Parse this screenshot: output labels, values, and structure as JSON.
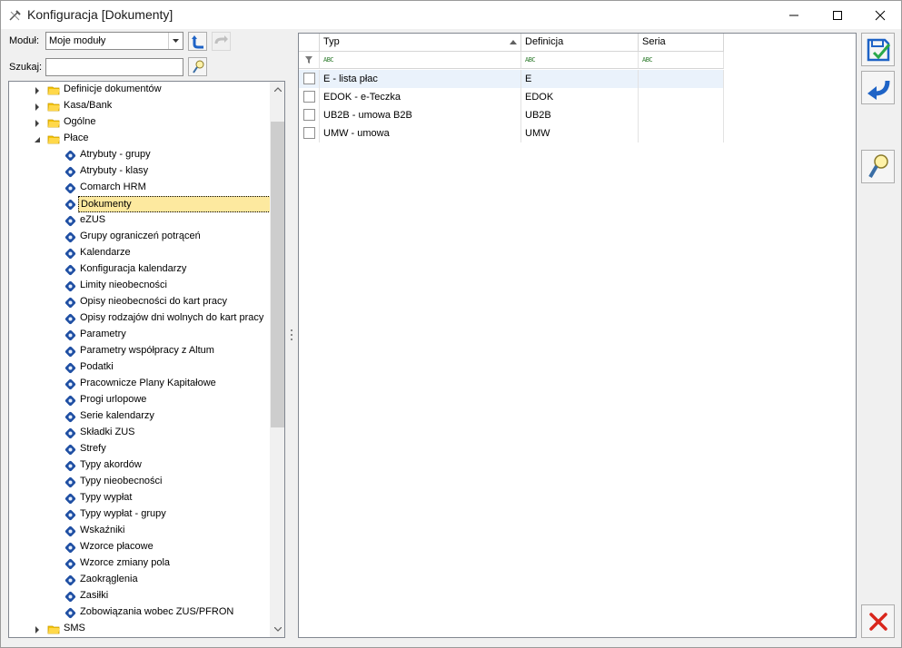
{
  "window": {
    "title": "Konfiguracja [Dokumenty]"
  },
  "toolbar": {
    "module_label": "Moduł:",
    "module_value": "Moje moduły",
    "search_label": "Szukaj:",
    "search_value": ""
  },
  "tree": {
    "items": [
      {
        "label": "Definicje dokumentów",
        "level": 0,
        "expander": "collapsed",
        "icon": "folder-icon"
      },
      {
        "label": "Kasa/Bank",
        "level": 0,
        "expander": "collapsed",
        "icon": "folder-icon"
      },
      {
        "label": "Ogólne",
        "level": 0,
        "expander": "collapsed",
        "icon": "folder-icon"
      },
      {
        "label": "Płace",
        "level": 0,
        "expander": "expanded",
        "icon": "folder-open-icon"
      },
      {
        "label": "Atrybuty - grupy",
        "level": 1,
        "icon": "config-item-icon"
      },
      {
        "label": "Atrybuty - klasy",
        "level": 1,
        "icon": "config-item-icon"
      },
      {
        "label": "Comarch HRM",
        "level": 1,
        "icon": "config-item-icon"
      },
      {
        "label": "Dokumenty",
        "level": 1,
        "icon": "config-item-icon",
        "selected": true
      },
      {
        "label": "eZUS",
        "level": 1,
        "icon": "config-item-icon"
      },
      {
        "label": "Grupy ograniczeń potrąceń",
        "level": 1,
        "icon": "config-item-icon"
      },
      {
        "label": "Kalendarze",
        "level": 1,
        "icon": "config-item-icon"
      },
      {
        "label": "Konfiguracja kalendarzy",
        "level": 1,
        "icon": "config-item-icon"
      },
      {
        "label": "Limity nieobecności",
        "level": 1,
        "icon": "config-item-icon"
      },
      {
        "label": "Opisy nieobecności do kart pracy",
        "level": 1,
        "icon": "config-item-icon"
      },
      {
        "label": "Opisy rodzajów dni wolnych do kart pracy",
        "level": 1,
        "icon": "config-item-icon"
      },
      {
        "label": "Parametry",
        "level": 1,
        "icon": "config-item-icon"
      },
      {
        "label": "Parametry współpracy z Altum",
        "level": 1,
        "icon": "config-item-icon"
      },
      {
        "label": "Podatki",
        "level": 1,
        "icon": "config-item-icon"
      },
      {
        "label": "Pracownicze Plany Kapitałowe",
        "level": 1,
        "icon": "config-item-icon"
      },
      {
        "label": "Progi urlopowe",
        "level": 1,
        "icon": "config-item-icon"
      },
      {
        "label": "Serie kalendarzy",
        "level": 1,
        "icon": "config-item-icon"
      },
      {
        "label": "Składki ZUS",
        "level": 1,
        "icon": "config-item-icon"
      },
      {
        "label": "Strefy",
        "level": 1,
        "icon": "config-item-icon"
      },
      {
        "label": "Typy akordów",
        "level": 1,
        "icon": "config-item-icon"
      },
      {
        "label": "Typy nieobecności",
        "level": 1,
        "icon": "config-item-icon"
      },
      {
        "label": "Typy wypłat",
        "level": 1,
        "icon": "config-item-icon"
      },
      {
        "label": "Typy wypłat - grupy",
        "level": 1,
        "icon": "config-item-icon"
      },
      {
        "label": "Wskaźniki",
        "level": 1,
        "icon": "config-item-icon"
      },
      {
        "label": "Wzorce płacowe",
        "level": 1,
        "icon": "config-item-icon"
      },
      {
        "label": "Wzorce zmiany pola",
        "level": 1,
        "icon": "config-item-icon"
      },
      {
        "label": "Zaokrąglenia",
        "level": 1,
        "icon": "config-item-icon"
      },
      {
        "label": "Zasiłki",
        "level": 1,
        "icon": "config-item-icon"
      },
      {
        "label": "Zobowiązania wobec ZUS/PFRON",
        "level": 1,
        "icon": "config-item-icon"
      },
      {
        "label": "SMS",
        "level": 0,
        "expander": "collapsed",
        "icon": "folder-icon"
      }
    ]
  },
  "grid": {
    "columns": [
      "Typ",
      "Definicja",
      "Seria"
    ],
    "filter_glyph": "ABC",
    "rows": [
      {
        "typ": "E - lista płac",
        "definicja": "E",
        "seria": ""
      },
      {
        "typ": "EDOK - e-Teczka",
        "definicja": "EDOK",
        "seria": ""
      },
      {
        "typ": "UB2B - umowa B2B",
        "definicja": "UB2B",
        "seria": ""
      },
      {
        "typ": "UMW - umowa",
        "definicja": "UMW",
        "seria": ""
      }
    ]
  },
  "colors": {
    "selection": "#fde99f",
    "folder": "#f5c400",
    "item_icon": "#1f4fa3",
    "accent_blue": "#1e63c6",
    "close_red": "#d9261c"
  }
}
